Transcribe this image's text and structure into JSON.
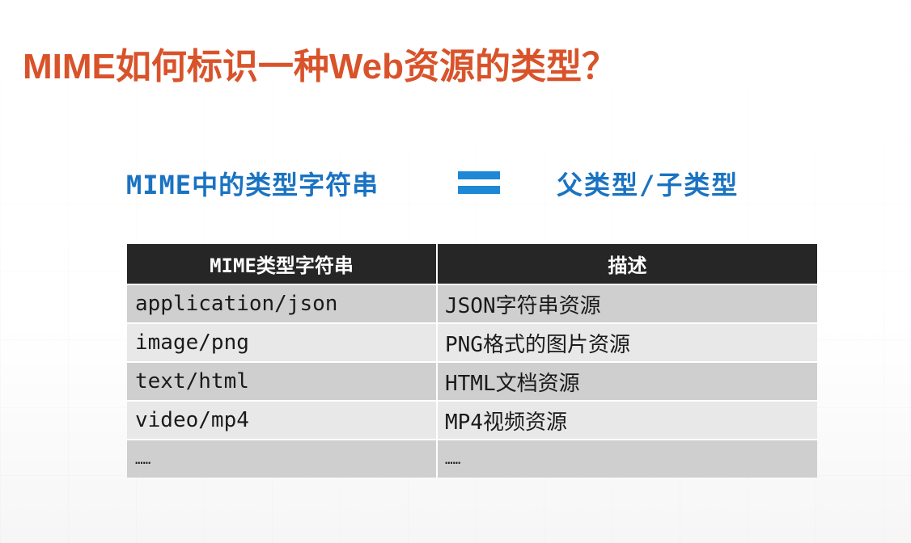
{
  "slide": {
    "title": "MIME如何标识一种Web资源的类型？",
    "equation": {
      "left": "MIME中的类型字符串",
      "right": "父类型/子类型"
    },
    "colors": {
      "title": "#d9532a",
      "accent": "#1a73c2",
      "header_bg": "#262626"
    }
  },
  "table": {
    "headers": [
      "MIME类型字符串",
      "描述"
    ],
    "rows": [
      [
        "application/json",
        "JSON字符串资源"
      ],
      [
        "image/png",
        "PNG格式的图片资源"
      ],
      [
        "text/html",
        "HTML文档资源"
      ],
      [
        "video/mp4",
        "MP4视频资源"
      ],
      [
        "……",
        "……"
      ]
    ]
  }
}
